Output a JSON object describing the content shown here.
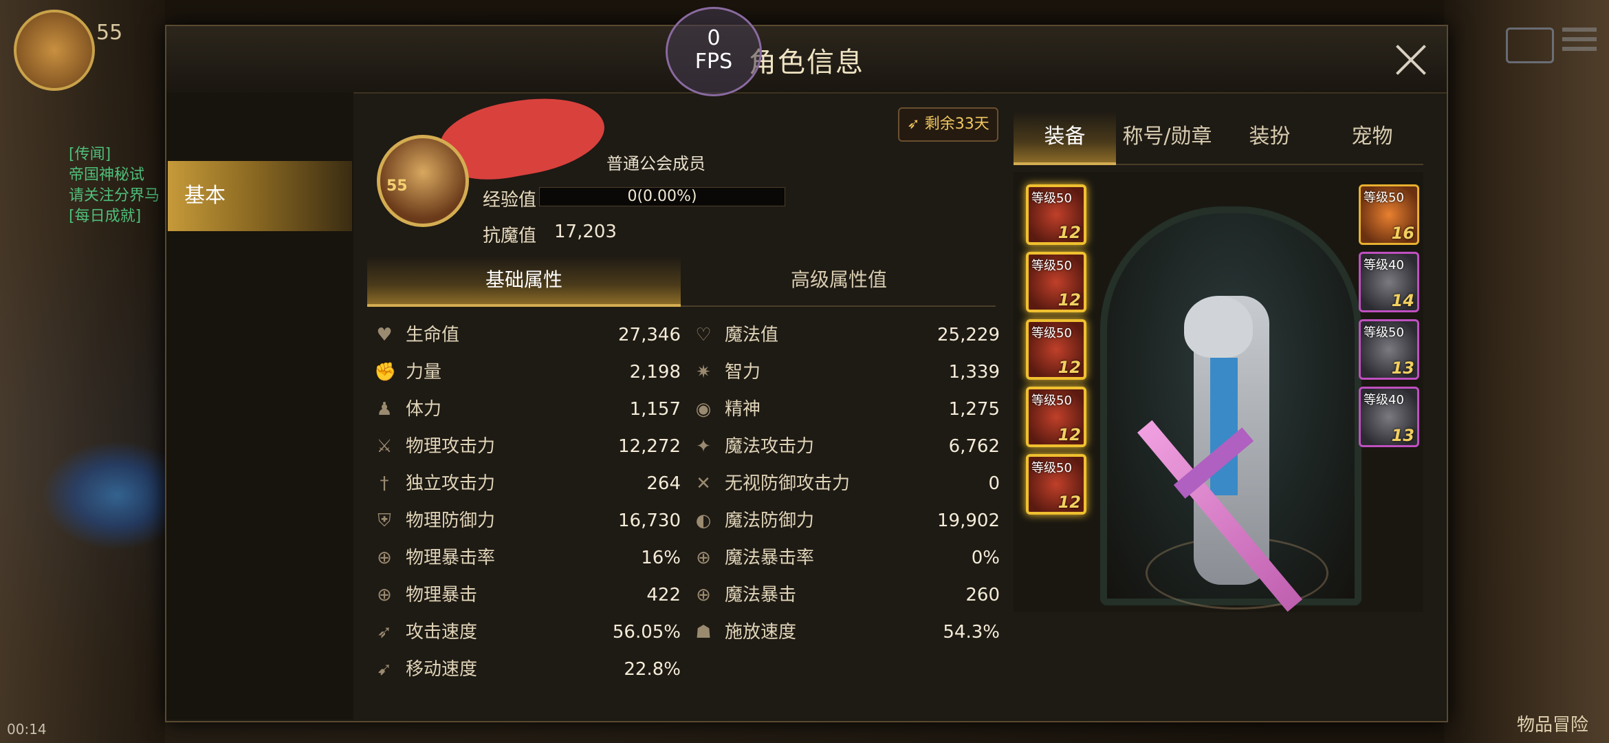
{
  "background": {
    "hud_level": "55",
    "quests": [
      "[传闻]",
      "帝国神秘试",
      "请关注分界马",
      "[每日成就]"
    ],
    "time": "00:14",
    "shop_label": "物品冒险"
  },
  "fps": {
    "value": "0",
    "label": "FPS"
  },
  "panel": {
    "title": "角色信息"
  },
  "side_nav": {
    "basic": "基本"
  },
  "profile": {
    "level": "55",
    "guild_rank": "普通公会成员",
    "exp_label": "经验值",
    "exp_value": "0(0.00%)",
    "exp_progress": 0.0,
    "resist_label": "抗魔值",
    "resist_value": "17,203",
    "remaining": "剩余33天"
  },
  "attr_tabs": {
    "basic": "基础属性",
    "advanced": "高级属性值"
  },
  "stats_left": [
    {
      "icon": "heart-icon",
      "glyph": "♥",
      "label": "生命值",
      "value": "27,346"
    },
    {
      "icon": "fist-icon",
      "glyph": "✊",
      "label": "力量",
      "value": "2,198"
    },
    {
      "icon": "body-icon",
      "glyph": "♟",
      "label": "体力",
      "value": "1,157"
    },
    {
      "icon": "sword-icon",
      "glyph": "⚔",
      "label": "物理攻击力",
      "value": "12,272"
    },
    {
      "icon": "dagger-icon",
      "glyph": "†",
      "label": "独立攻击力",
      "value": "264"
    },
    {
      "icon": "shield-icon",
      "glyph": "⛨",
      "label": "物理防御力",
      "value": "16,730"
    },
    {
      "icon": "crosshair-icon",
      "glyph": "⊕",
      "label": "物理暴击率",
      "value": "16%"
    },
    {
      "icon": "crosshair-icon",
      "glyph": "⊕",
      "label": "物理暴击",
      "value": "422"
    },
    {
      "icon": "speed-icon",
      "glyph": "➶",
      "label": "攻击速度",
      "value": "56.05%"
    },
    {
      "icon": "boot-icon",
      "glyph": "➹",
      "label": "移动速度",
      "value": "22.8%"
    }
  ],
  "stats_right": [
    {
      "icon": "heart-outline-icon",
      "glyph": "♡",
      "label": "魔法值",
      "value": "25,229"
    },
    {
      "icon": "spark-icon",
      "glyph": "✷",
      "label": "智力",
      "value": "1,339"
    },
    {
      "icon": "eye-icon",
      "glyph": "◉",
      "label": "精神",
      "value": "1,275"
    },
    {
      "icon": "magic-star-icon",
      "glyph": "✦",
      "label": "魔法攻击力",
      "value": "6,762"
    },
    {
      "icon": "cross-icon",
      "glyph": "✕",
      "label": "无视防御攻击力",
      "value": "0"
    },
    {
      "icon": "orb-icon",
      "glyph": "◐",
      "label": "魔法防御力",
      "value": "19,902"
    },
    {
      "icon": "crosshair-icon",
      "glyph": "⊕",
      "label": "魔法暴击率",
      "value": "0%"
    },
    {
      "icon": "crosshair-icon",
      "glyph": "⊕",
      "label": "魔法暴击",
      "value": "260"
    },
    {
      "icon": "cast-icon",
      "glyph": "☗",
      "label": "施放速度",
      "value": "54.3%"
    }
  ],
  "equip_tabs": [
    "装备",
    "称号/勋章",
    "装扮",
    "宠物"
  ],
  "left_slots": [
    {
      "level": "等级50",
      "enh": "12"
    },
    {
      "level": "等级50",
      "enh": "12"
    },
    {
      "level": "等级50",
      "enh": "12"
    },
    {
      "level": "等级50",
      "enh": "12"
    },
    {
      "level": "等级50",
      "enh": "12"
    }
  ],
  "right_slots": [
    {
      "level": "等级50",
      "enh": "16",
      "rarity": "orange"
    },
    {
      "level": "等级40",
      "enh": "14",
      "rarity": "purple"
    },
    {
      "level": "等级50",
      "enh": "13",
      "rarity": "purple"
    },
    {
      "level": "等级40",
      "enh": "13",
      "rarity": "purple"
    }
  ]
}
